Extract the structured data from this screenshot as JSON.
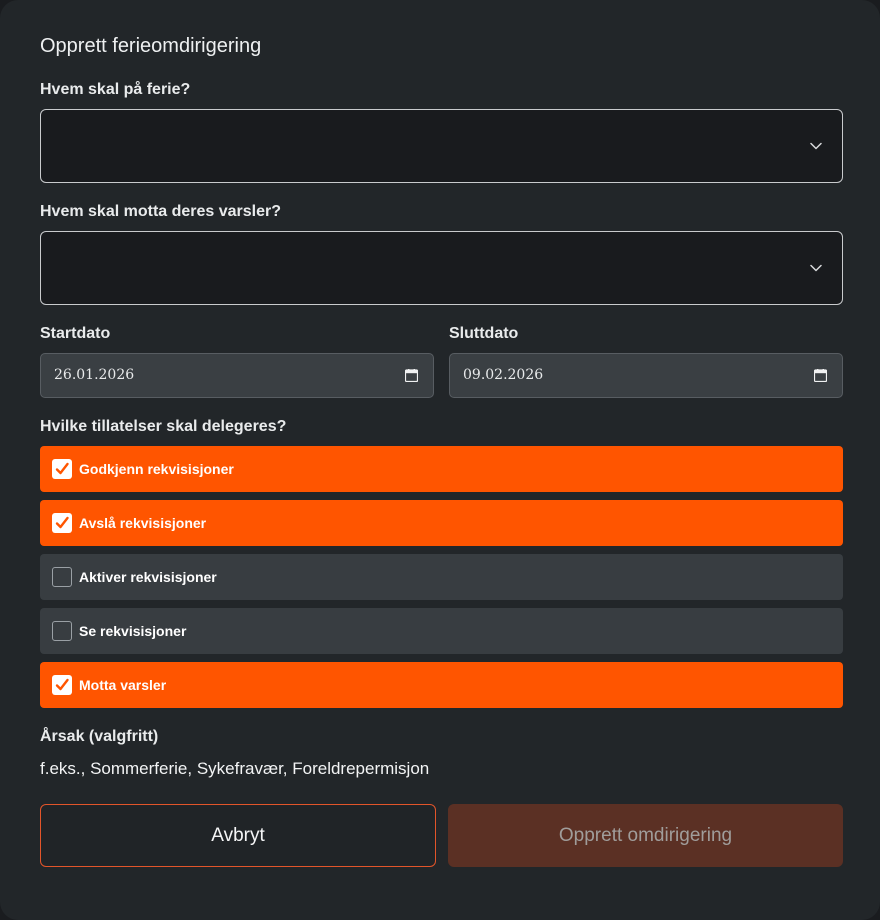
{
  "dialog": {
    "title": "Opprett ferieomdirigering",
    "who_vacation_label": "Hvem skal på ferie?",
    "who_vacation_value": "",
    "who_receive_label": "Hvem skal motta deres varsler?",
    "who_receive_value": "",
    "start_label": "Startdato",
    "start_value": "26.01.2026",
    "end_label": "Sluttdato",
    "end_value": "09.02.2026",
    "permissions_label": "Hvilke tillatelser skal delegeres?",
    "permissions": [
      {
        "label": "Godkjenn rekvisisjoner",
        "checked": true
      },
      {
        "label": "Avslå rekvisisjoner",
        "checked": true
      },
      {
        "label": "Aktiver rekvisisjoner",
        "checked": false
      },
      {
        "label": "Se rekvisisjoner",
        "checked": false
      },
      {
        "label": "Motta varsler",
        "checked": true
      }
    ],
    "reason_label": "Årsak (valgfritt)",
    "reason_placeholder": "f.eks., Sommerferie, Sykefravær, Foreldrepermisjon",
    "cancel_label": "Avbryt",
    "submit_label": "Opprett omdirigering"
  },
  "colors": {
    "accent": "#ff5500",
    "panel": "#222629",
    "submit_disabled": "#5b3024"
  },
  "icons": {
    "select_chevron": "chevron-down-icon",
    "date_picker": "calendar-icon",
    "checkbox_checked": "checkmark-icon"
  }
}
